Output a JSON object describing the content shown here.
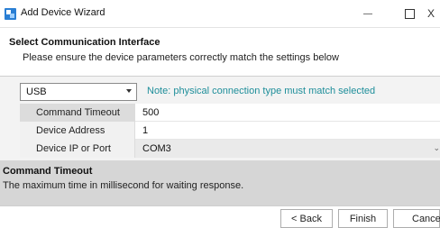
{
  "window": {
    "title": "Add Device Wizard",
    "close_glyph": "X"
  },
  "header": {
    "title": "Select Communication Interface",
    "subtitle": "Please ensure the device parameters correctly match the settings below"
  },
  "connection": {
    "selected": "USB",
    "note": "Note: physical connection type must match selected"
  },
  "properties": [
    {
      "label": "Command Timeout",
      "value": "500"
    },
    {
      "label": "Device Address",
      "value": "1"
    },
    {
      "label": "Device IP or Port",
      "value": "COM3"
    }
  ],
  "description": {
    "title": "Command Timeout",
    "text": "The maximum time in millisecond for waiting response."
  },
  "footer": {
    "back_label": "< Back",
    "finish_label": "Finish",
    "cancel_label": "Cancel"
  },
  "colors": {
    "note": "#1e8e9a",
    "description_bg": "#d6d6d6",
    "app_icon": "#2a7fd4"
  },
  "icons": {
    "app": "wizard-app-icon",
    "dropdown": "chevron-down-icon"
  }
}
